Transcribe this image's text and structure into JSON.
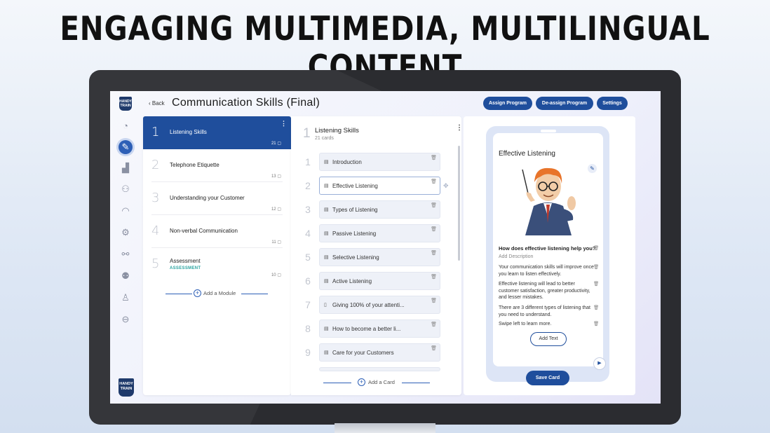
{
  "headline": "ENGAGING MULTIMEDIA, MULTILINGUAL CONTENT",
  "brand": {
    "logo_text": "HANDY TRAIN",
    "accent": "#1f4e9c"
  },
  "header": {
    "back_label": "‹ Back",
    "title": "Communication Skills (Final)",
    "buttons": [
      "Assign Program",
      "De-assign Program",
      "Settings"
    ]
  },
  "rail_icons": [
    "dashboard-icon",
    "programs-icon",
    "analytics-icon",
    "users-icon",
    "broadcast-icon",
    "settings-icon",
    "workflow-icon",
    "groups-icon",
    "profile-icon",
    "logout-icon"
  ],
  "modules": {
    "items": [
      {
        "num": "1",
        "name": "Listening Skills",
        "count": "21",
        "tag": ""
      },
      {
        "num": "2",
        "name": "Telephone Etiquette",
        "count": "13",
        "tag": ""
      },
      {
        "num": "3",
        "name": "Understanding your Customer",
        "count": "12",
        "tag": ""
      },
      {
        "num": "4",
        "name": "Non-verbal Communication",
        "count": "11",
        "tag": ""
      },
      {
        "num": "5",
        "name": "Assessment",
        "count": "10",
        "tag": "ASSESSMENT"
      }
    ],
    "add_label": "Add a Module"
  },
  "cards": {
    "number": "1",
    "title": "Listening Skills",
    "subtitle": "21 cards",
    "items": [
      {
        "num": "1",
        "label": "Introduction",
        "icon": "lesson-icon"
      },
      {
        "num": "2",
        "label": "Effective Listening",
        "icon": "lesson-icon"
      },
      {
        "num": "3",
        "label": "Types of Listening",
        "icon": "lesson-icon"
      },
      {
        "num": "4",
        "label": "Passive Listening",
        "icon": "lesson-icon"
      },
      {
        "num": "5",
        "label": "Selective Listening",
        "icon": "lesson-icon"
      },
      {
        "num": "6",
        "label": "Active Listening",
        "icon": "lesson-icon"
      },
      {
        "num": "7",
        "label": "Giving 100% of your attenti...",
        "icon": "video-icon"
      },
      {
        "num": "8",
        "label": "How to become a better li...",
        "icon": "lesson-icon"
      },
      {
        "num": "9",
        "label": "Care for your Customers",
        "icon": "lesson-icon"
      }
    ],
    "add_label": "Add a Card"
  },
  "preview": {
    "title": "Effective Listening",
    "question": "How does effective listening help you?",
    "description_placeholder": "Add Description",
    "paragraphs": [
      "Your communication skills will improve once you learn to listen effectively.",
      "Effective listening will lead to better customer satisfaction, greater productivity, and lesser mistakes.",
      "There are 3 different types of listening that you need to understand.",
      "Swipe left to learn more."
    ],
    "add_text_label": "Add Text",
    "save_label": "Save Card"
  }
}
